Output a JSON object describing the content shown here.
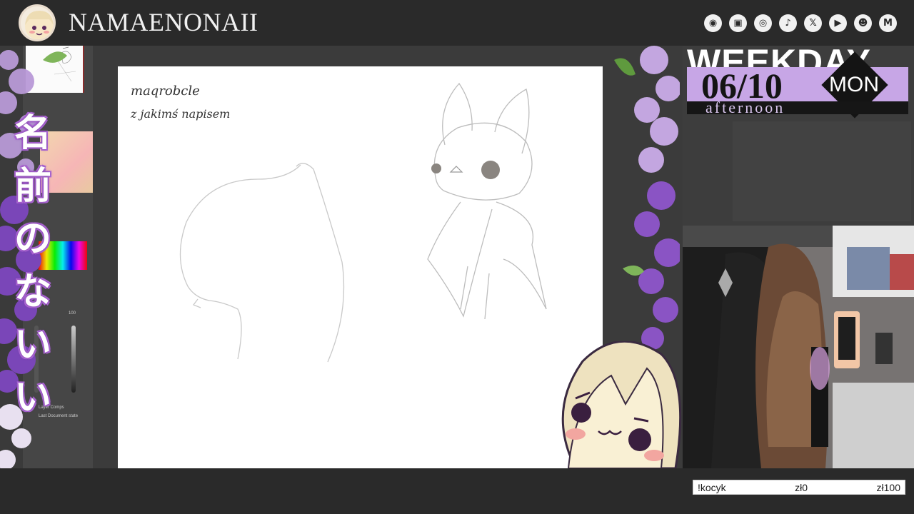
{
  "header": {
    "channel_name": "NAMAENONAII",
    "socials": [
      {
        "icon": "droplet-icon",
        "glyph": "◉"
      },
      {
        "icon": "twitch-icon",
        "glyph": "▣"
      },
      {
        "icon": "instagram-icon",
        "glyph": "◎"
      },
      {
        "icon": "tiktok-icon",
        "glyph": "♪"
      },
      {
        "icon": "x-icon",
        "glyph": "𝕏"
      },
      {
        "icon": "youtube-icon",
        "glyph": "▶"
      },
      {
        "icon": "discord-icon",
        "glyph": "☻"
      },
      {
        "icon": "mail-icon",
        "glyph": "M"
      }
    ]
  },
  "sidebar": {
    "kanji": [
      "名",
      "前",
      "の",
      "な",
      "い",
      "い"
    ],
    "tool_labels": {
      "layer_comps": "Layer Comps",
      "last_doc_state": "Last Document state",
      "percent": "100"
    }
  },
  "canvas": {
    "note_line1": "maqrobcle",
    "note_line2": "z jakimś napisem"
  },
  "schedule": {
    "title": "WEEKDAY",
    "date": "06/10",
    "day": "MON",
    "time_of_day": "afternoon"
  },
  "goal": {
    "command": "!kocyk",
    "current": "zł0",
    "target": "zł100"
  },
  "colors": {
    "accent_lilac": "#c7a6e6",
    "purple_flowers": "#8c5cc4",
    "dark_bg": "#2a2a2a"
  }
}
